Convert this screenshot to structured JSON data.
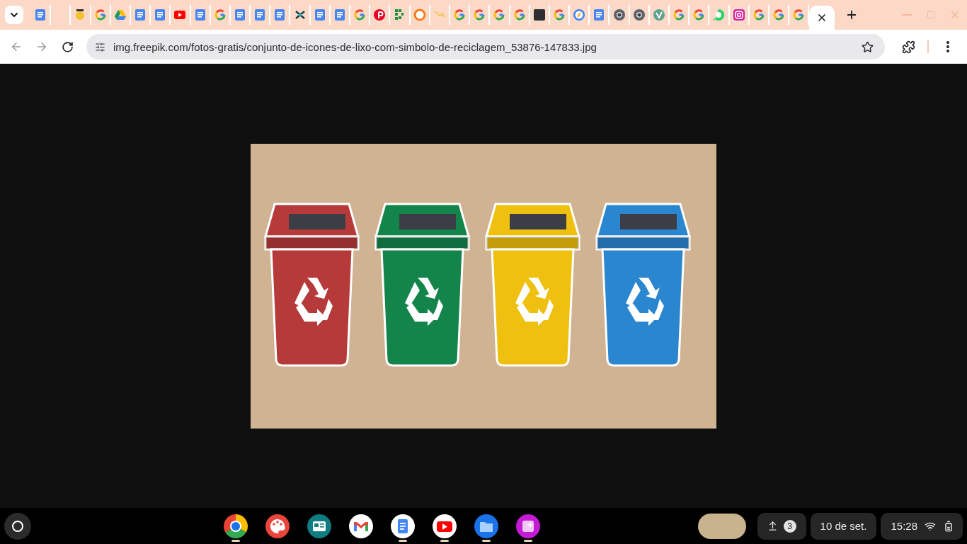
{
  "tabs": [
    {
      "kind": "doc",
      "selected": false
    },
    {
      "kind": "blank",
      "selected": false
    },
    {
      "kind": "scholar",
      "selected": false
    },
    {
      "kind": "google",
      "selected": false
    },
    {
      "kind": "drive",
      "selected": false
    },
    {
      "kind": "doc",
      "selected": false
    },
    {
      "kind": "doc",
      "selected": false
    },
    {
      "kind": "youtube",
      "selected": false
    },
    {
      "kind": "doc",
      "selected": false
    },
    {
      "kind": "google",
      "selected": false
    },
    {
      "kind": "doc",
      "selected": false
    },
    {
      "kind": "doc",
      "selected": false
    },
    {
      "kind": "doc",
      "selected": false
    },
    {
      "kind": "cross",
      "selected": false
    },
    {
      "kind": "doc",
      "selected": false
    },
    {
      "kind": "doc",
      "selected": false
    },
    {
      "kind": "google",
      "selected": false
    },
    {
      "kind": "pinterest",
      "selected": false
    },
    {
      "kind": "grid",
      "selected": false
    },
    {
      "kind": "orange",
      "selected": false
    },
    {
      "kind": "squiggle",
      "selected": false
    },
    {
      "kind": "google",
      "selected": false
    },
    {
      "kind": "google",
      "selected": false
    },
    {
      "kind": "google",
      "selected": false
    },
    {
      "kind": "google",
      "selected": false
    },
    {
      "kind": "ego",
      "selected": false
    },
    {
      "kind": "google",
      "selected": false
    },
    {
      "kind": "compass",
      "selected": false
    },
    {
      "kind": "doc",
      "selected": false
    },
    {
      "kind": "chrome",
      "selected": false
    },
    {
      "kind": "chrome",
      "selected": false
    },
    {
      "kind": "leaf",
      "selected": false
    },
    {
      "kind": "google",
      "selected": false
    },
    {
      "kind": "google",
      "selected": false
    },
    {
      "kind": "whatsapp",
      "selected": false
    },
    {
      "kind": "instagram",
      "selected": false
    },
    {
      "kind": "google",
      "selected": false
    },
    {
      "kind": "google",
      "selected": false
    },
    {
      "kind": "google",
      "selected": false
    },
    {
      "selected": true
    }
  ],
  "address_bar": {
    "url": "img.freepik.com/fotos-gratis/conjunto-de-icones-de-lixo-com-simbolo-de-reciclagem_53876-147833.jpg"
  },
  "image": {
    "bins": [
      {
        "color": "#b63a3a"
      },
      {
        "color": "#13844a"
      },
      {
        "color": "#efc010"
      },
      {
        "color": "#2a86cf"
      }
    ]
  },
  "shelf": {
    "apps": [
      {
        "kind": "chrome",
        "running": true
      },
      {
        "kind": "palette",
        "running": false
      },
      {
        "kind": "news",
        "running": false
      },
      {
        "kind": "gmail",
        "running": false
      },
      {
        "kind": "docs",
        "running": true
      },
      {
        "kind": "youtube",
        "running": true
      },
      {
        "kind": "files",
        "running": true
      },
      {
        "kind": "sparkle",
        "running": true
      }
    ],
    "notification_count": "3",
    "date": "10 de set.",
    "time": "15:28"
  }
}
